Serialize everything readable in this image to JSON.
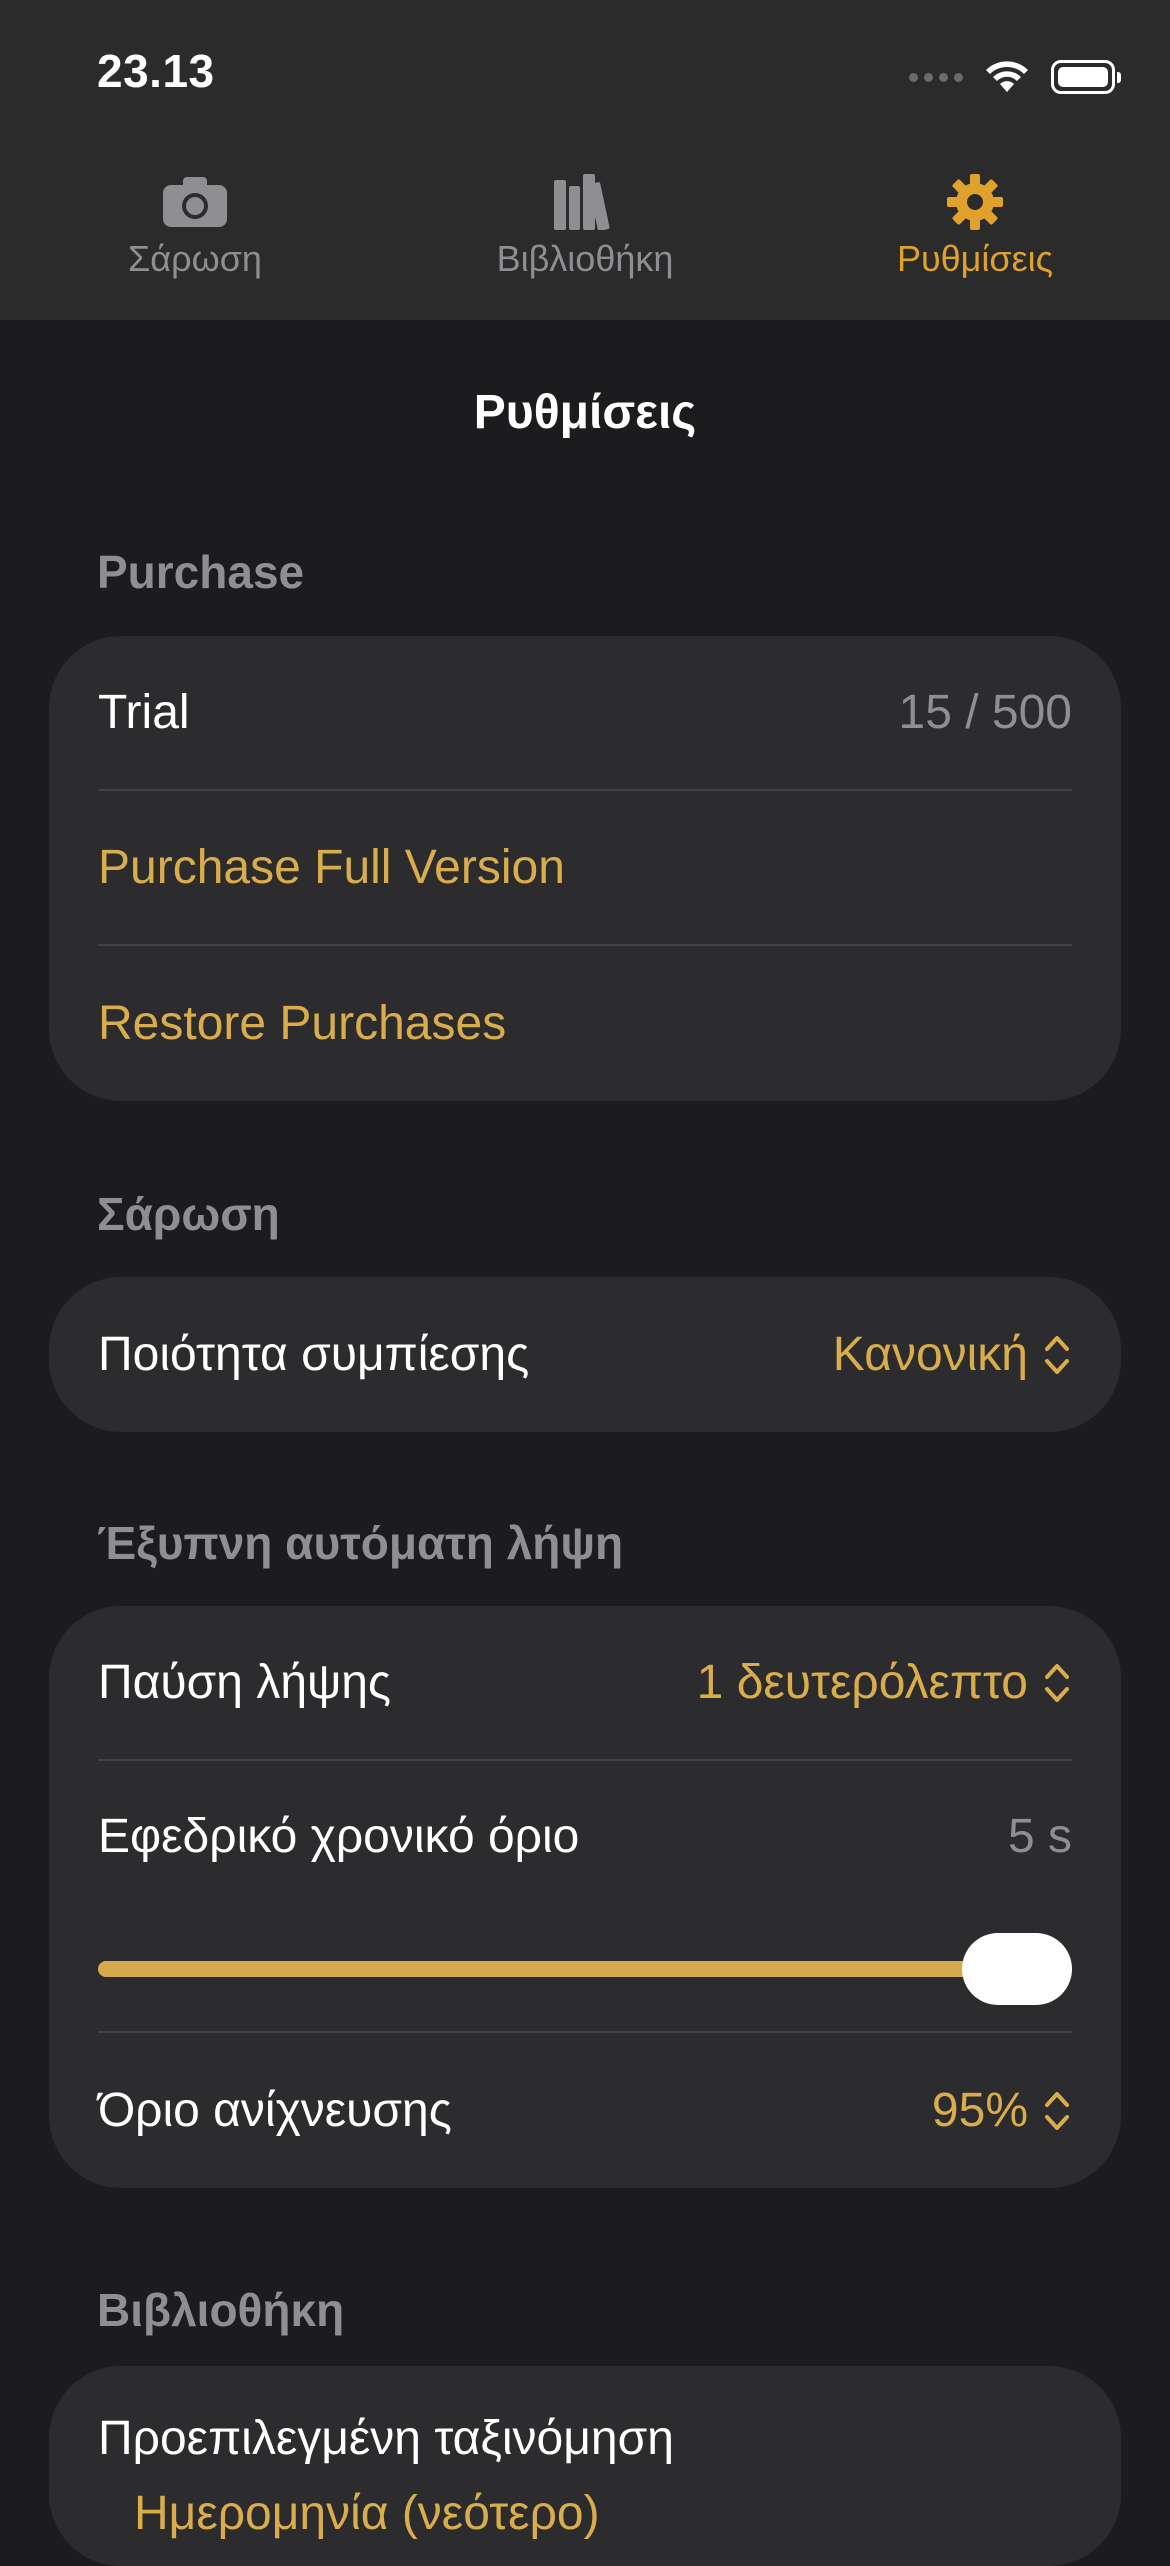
{
  "status_bar": {
    "time": "23.13"
  },
  "tabs": [
    {
      "label": "Σάρωση",
      "icon": "camera-icon",
      "active": false
    },
    {
      "label": "Βιβλιοθήκη",
      "icon": "books-icon",
      "active": false
    },
    {
      "label": "Ρυθμίσεις",
      "icon": "gear-icon",
      "active": true
    }
  ],
  "page_title": "Ρυθμίσεις",
  "purchase": {
    "title": "Purchase",
    "trial_label": "Trial",
    "trial_value": "15 / 500",
    "buy_label": "Purchase Full Version",
    "restore_label": "Restore Purchases"
  },
  "scan": {
    "title": "Σάρωση",
    "compression_label": "Ποιότητα συμπίεσης",
    "compression_value": "Κανονική"
  },
  "smart_capture": {
    "title": "Έξυπνη αυτόματη λήψη",
    "pause_label": "Παύση λήψης",
    "pause_value": "1 δευτερόλεπτο",
    "timeout_label": "Εφεδρικό χρονικό όριο",
    "timeout_value": "5 s",
    "timeout_slider_fraction": 1.0,
    "threshold_label": "Όριο ανίχνευσης",
    "threshold_value": "95%"
  },
  "library": {
    "title": "Βιβλιοθήκη",
    "sort_label": "Προεπιλεγμένη ταξινόμηση",
    "sort_value": "Ημερομηνία (νεότερο)"
  },
  "colors": {
    "accent": "#e0a12d",
    "gold_text": "#d9ad4b"
  }
}
